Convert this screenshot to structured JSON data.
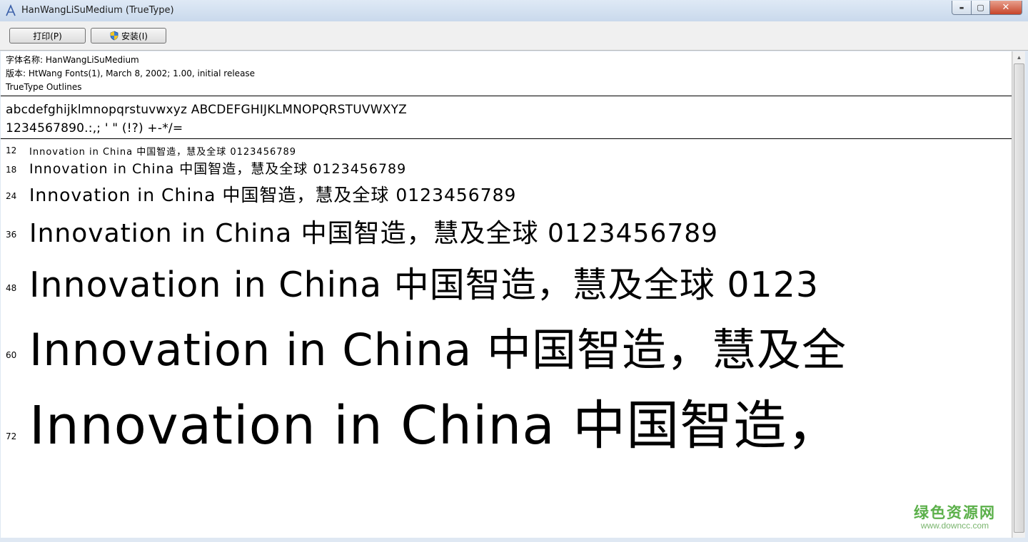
{
  "window": {
    "title": "HanWangLiSuMedium (TrueType)",
    "icon": "font-a-icon",
    "controls": {
      "minimize": "▬",
      "maximize": "▢",
      "close": "✕"
    }
  },
  "toolbar": {
    "print_label": "打印(P)",
    "install_label": "安装(I)"
  },
  "font_info": {
    "name_line": "字体名称: HanWangLiSuMedium",
    "version_line": "版本: HtWang Fonts(1), March 8, 2002; 1.00, initial release",
    "type_line": "TrueType Outlines"
  },
  "charset": {
    "line1": "abcdefghijklmnopqrstuvwxyz ABCDEFGHIJKLMNOPQRSTUVWXYZ",
    "line2": "1234567890.:,; ' \" (!?) +-*/="
  },
  "samples": [
    {
      "size": "12",
      "text": "Innovation in China 中国智造，慧及全球 0123456789"
    },
    {
      "size": "18",
      "text": "Innovation in China 中国智造，慧及全球 0123456789"
    },
    {
      "size": "24",
      "text": "Innovation in China 中国智造，慧及全球 0123456789"
    },
    {
      "size": "36",
      "text": "Innovation in China 中国智造，慧及全球 0123456789"
    },
    {
      "size": "48",
      "text": "Innovation in China 中国智造，慧及全球 0123"
    },
    {
      "size": "60",
      "text": "Innovation in China 中国智造，慧及全"
    },
    {
      "size": "72",
      "text": "Innovation in China 中国智造，"
    }
  ],
  "watermark": {
    "brand": "绿色资源网",
    "url": "www.downcc.com"
  }
}
